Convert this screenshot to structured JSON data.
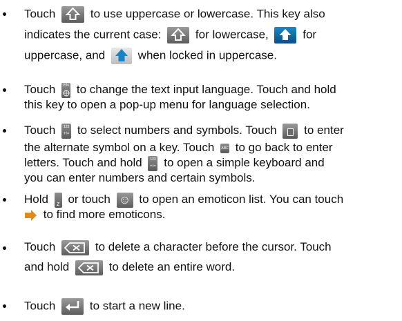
{
  "items": [
    {
      "lines": [
        [
          "Touch",
          "to use uppercase or lowercase. This key also"
        ],
        [
          "indicates the current case:",
          "for lowercase,",
          "for"
        ],
        [
          "uppercase, and",
          "when locked in uppercase."
        ]
      ]
    },
    {
      "lines": [
        [
          "Touch",
          "to change the text input language. Touch and hold"
        ],
        [
          "this key to open a pop-up menu for language selection."
        ]
      ]
    },
    {
      "lines": [
        [
          "Touch",
          "to select numbers and symbols. Touch",
          "to enter"
        ],
        [
          "the alternate symbol on a key. Touch",
          "to go back to enter"
        ],
        [
          "letters. Touch and hold",
          "to open a simple keyboard and"
        ],
        [
          "you can enter numbers and certain symbols."
        ]
      ]
    },
    {
      "lines": [
        [
          "Hold",
          "or touch",
          "to open an emoticon list. You can touch"
        ],
        [
          "to find more emoticons."
        ]
      ]
    },
    {
      "lines": [
        [
          "Touch",
          "to delete a character before the cursor. Touch"
        ],
        [
          "and hold",
          "to delete an entire word."
        ]
      ]
    },
    {
      "lines": [
        [
          "Touch",
          "to start a new line."
        ]
      ]
    }
  ],
  "icons": {
    "shift_key": "shift-key-icon",
    "shift_lower": "shift-lowercase-icon",
    "shift_upper": "shift-uppercase-icon",
    "shift_locked": "shift-locked-icon",
    "language_key": "language-key-icon",
    "language_key_label": "EN",
    "symbol_key": "symbol-key-icon",
    "symbol_key_label_top": "123",
    "symbol_key_label_bottom": "+!=",
    "alt_symbol_key": "alternate-symbol-key-icon",
    "abc_key": "abc-key-icon",
    "abc_key_label": "ABC",
    "voice_key": "z-key-icon",
    "voice_key_label": "z",
    "emoticon_key": "emoticon-key-icon",
    "emoticon_glyph": "☺",
    "more_arrow": "more-arrow-icon",
    "delete_key": "delete-key-icon",
    "delete_glyph": "⌫",
    "enter_key": "enter-key-icon",
    "colors": {
      "shift_blue": "#1a82c4",
      "key_grey": "#6e6e6e",
      "arrow_orange": "#e08a1e"
    }
  }
}
